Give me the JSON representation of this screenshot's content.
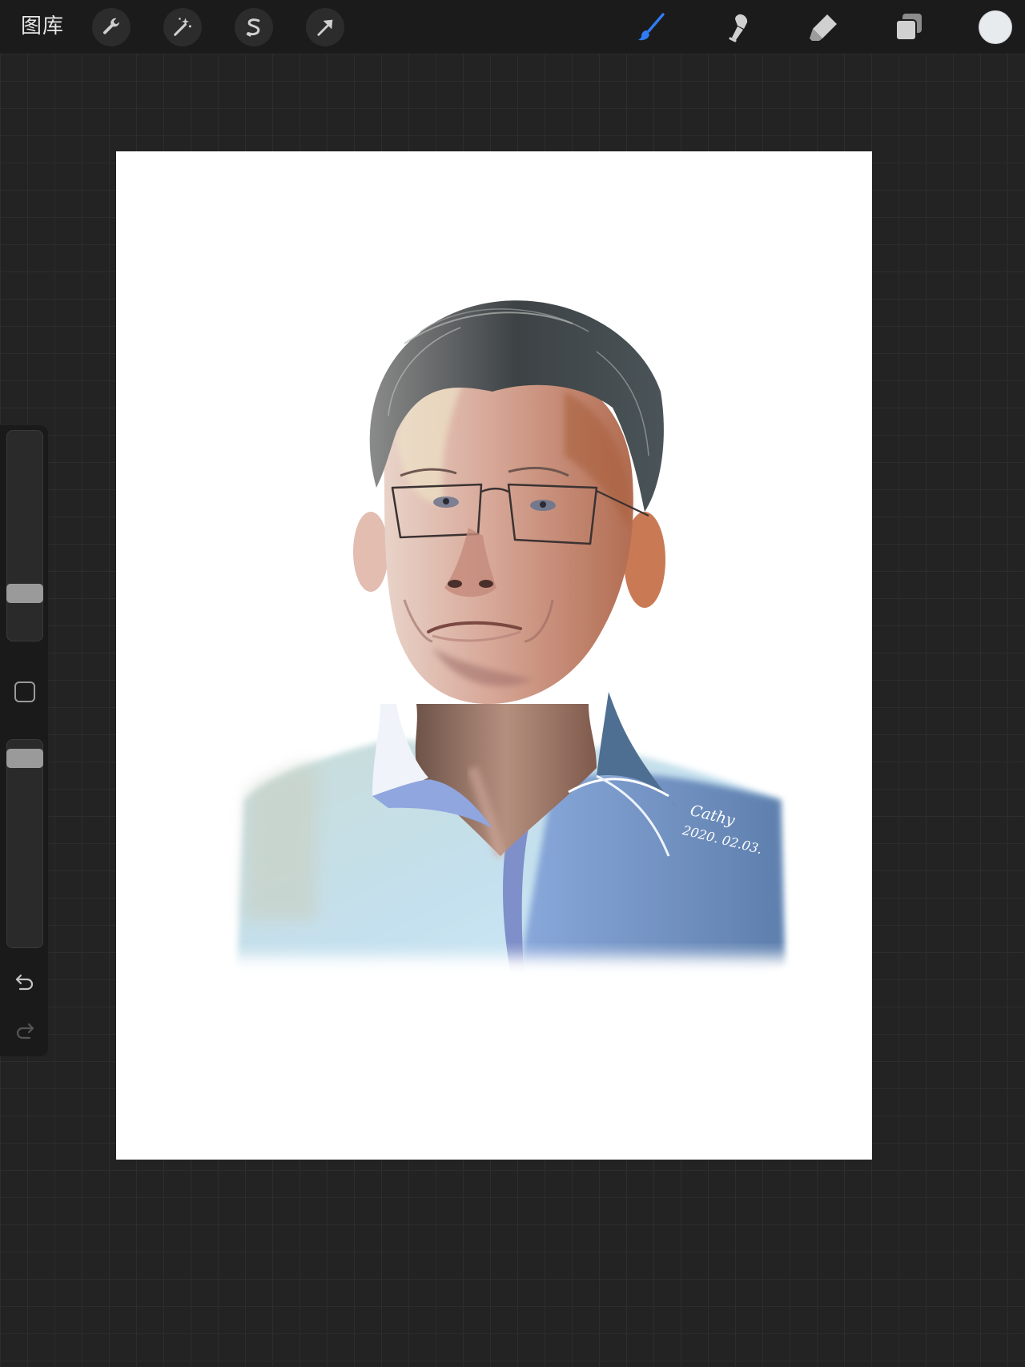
{
  "topbar": {
    "gallery_label": "图库",
    "left_tools": [
      {
        "name": "actions",
        "icon": "wrench-icon"
      },
      {
        "name": "adjustments",
        "icon": "magic-wand-icon"
      },
      {
        "name": "selection",
        "icon": "selection-s-icon"
      },
      {
        "name": "transform",
        "icon": "arrow-cursor-icon"
      }
    ],
    "right_tools": [
      {
        "name": "brush",
        "icon": "brush-icon",
        "active": true
      },
      {
        "name": "smudge",
        "icon": "smudge-icon",
        "active": false
      },
      {
        "name": "eraser",
        "icon": "eraser-icon",
        "active": false
      },
      {
        "name": "layers",
        "icon": "layers-icon",
        "active": false
      }
    ],
    "current_color": "#e8ebee"
  },
  "sidebar": {
    "brush_size_level": 0.2,
    "brush_opacity_level": 0.95,
    "modify_button": "square-icon",
    "undo": "undo-icon",
    "redo": "redo-icon"
  },
  "canvas": {
    "background": "#ffffff",
    "artwork": "portrait-painting",
    "signature_name": "Cathy",
    "signature_date": "2020. 02.03."
  },
  "colors": {
    "accent": "#2f7cf6",
    "toolbar_bg": "#1b1b1b",
    "workspace_bg": "#232323"
  }
}
